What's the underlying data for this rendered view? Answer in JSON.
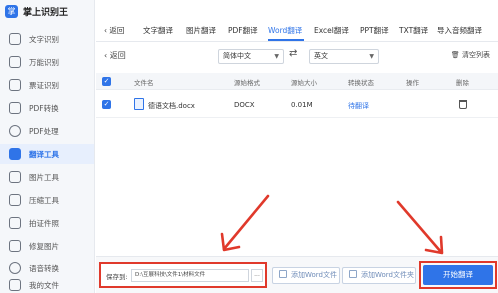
{
  "app": {
    "logo_text": "掌",
    "name": "掌上识别王"
  },
  "sidebar": {
    "items": [
      {
        "label": "文字识别",
        "icon": "text-recognition-icon"
      },
      {
        "label": "万能识别",
        "icon": "universal-recognition-icon"
      },
      {
        "label": "票证识别",
        "icon": "ticket-recognition-icon"
      },
      {
        "label": "PDF转换",
        "icon": "pdf-convert-icon"
      },
      {
        "label": "PDF处理",
        "icon": "pdf-process-icon"
      },
      {
        "label": "翻译工具",
        "icon": "translate-tool-icon",
        "active": true
      },
      {
        "label": "图片工具",
        "icon": "image-tool-icon"
      },
      {
        "label": "压缩工具",
        "icon": "compress-tool-icon"
      },
      {
        "label": "拍证件照",
        "icon": "id-photo-icon"
      },
      {
        "label": "修复图片",
        "icon": "repair-image-icon"
      },
      {
        "label": "语音转换",
        "icon": "voice-convert-icon"
      },
      {
        "label": "我的文件",
        "icon": "my-files-icon"
      }
    ]
  },
  "tabs": {
    "back_label": "返回",
    "items": [
      "文字翻译",
      "图片翻译",
      "PDF翻译",
      "Word翻译",
      "Excel翻译",
      "PPT翻译",
      "TXT翻译",
      "导入音频翻译"
    ],
    "active": "Word翻译"
  },
  "toolbar": {
    "back_label": "返回",
    "source_language": "简体中文",
    "target_language": "英文",
    "clear_label": "清空列表"
  },
  "table": {
    "headers": [
      "文件名",
      "源始格式",
      "源始大小",
      "转换状态",
      "操作",
      "删除"
    ],
    "rows": [
      {
        "filename": "德语文档.docx",
        "format": "DOCX",
        "size": "0.01M",
        "status": "待翻译"
      }
    ]
  },
  "bottom": {
    "save_label": "保存到:",
    "save_path": "D:\\互展科技\\文件1\\材料文件",
    "more_label": "...",
    "add_file_label": "添加Word文件",
    "add_folder_label": "添加Word文件夹",
    "start_label": "开始翻译"
  },
  "colors": {
    "accent": "#2f74e8",
    "highlight": "#e0392b"
  }
}
